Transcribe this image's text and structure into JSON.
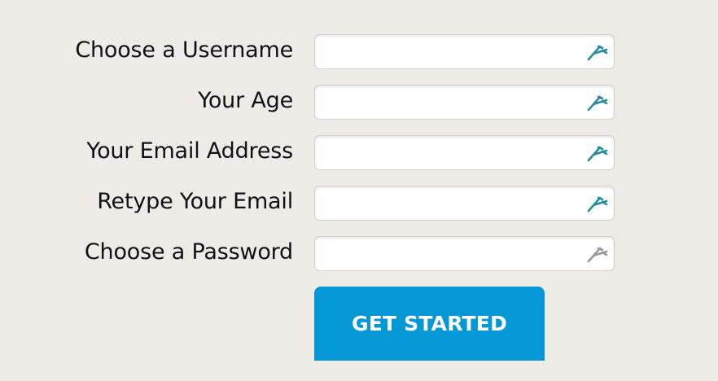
{
  "form": {
    "fields": [
      {
        "label": "Choose a Username",
        "value": "",
        "icon": "key-icon",
        "icon_color": "#2a8c9b"
      },
      {
        "label": "Your Age",
        "value": "",
        "icon": "key-icon",
        "icon_color": "#2a8c9b"
      },
      {
        "label": "Your Email Address",
        "value": "",
        "icon": "key-icon",
        "icon_color": "#2a8c9b"
      },
      {
        "label": "Retype Your Email",
        "value": "",
        "icon": "key-icon",
        "icon_color": "#2a8c9b"
      },
      {
        "label": "Choose a Password",
        "value": "",
        "icon": "key-icon",
        "icon_color": "#9a9a9a"
      }
    ],
    "submit_label": "GET STARTED"
  },
  "colors": {
    "background": "#efece8",
    "button": "#0497d6",
    "button_text": "#ffffff",
    "label_text": "#111111"
  }
}
